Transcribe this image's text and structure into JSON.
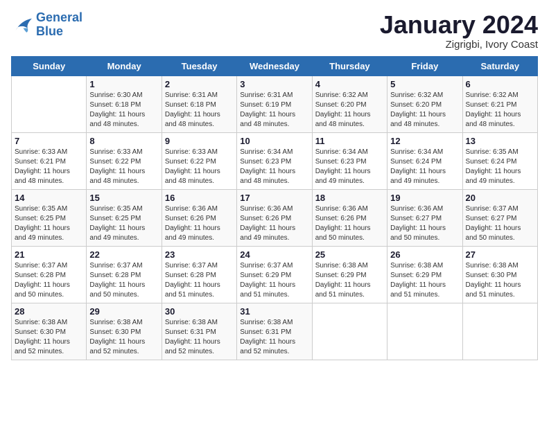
{
  "header": {
    "logo_line1": "General",
    "logo_line2": "Blue",
    "title": "January 2024",
    "subtitle": "Zigrigbi, Ivory Coast"
  },
  "weekdays": [
    "Sunday",
    "Monday",
    "Tuesday",
    "Wednesday",
    "Thursday",
    "Friday",
    "Saturday"
  ],
  "weeks": [
    [
      {
        "day": "",
        "detail": ""
      },
      {
        "day": "1",
        "detail": "Sunrise: 6:30 AM\nSunset: 6:18 PM\nDaylight: 11 hours\nand 48 minutes."
      },
      {
        "day": "2",
        "detail": "Sunrise: 6:31 AM\nSunset: 6:18 PM\nDaylight: 11 hours\nand 48 minutes."
      },
      {
        "day": "3",
        "detail": "Sunrise: 6:31 AM\nSunset: 6:19 PM\nDaylight: 11 hours\nand 48 minutes."
      },
      {
        "day": "4",
        "detail": "Sunrise: 6:32 AM\nSunset: 6:20 PM\nDaylight: 11 hours\nand 48 minutes."
      },
      {
        "day": "5",
        "detail": "Sunrise: 6:32 AM\nSunset: 6:20 PM\nDaylight: 11 hours\nand 48 minutes."
      },
      {
        "day": "6",
        "detail": "Sunrise: 6:32 AM\nSunset: 6:21 PM\nDaylight: 11 hours\nand 48 minutes."
      }
    ],
    [
      {
        "day": "7",
        "detail": "Sunrise: 6:33 AM\nSunset: 6:21 PM\nDaylight: 11 hours\nand 48 minutes."
      },
      {
        "day": "8",
        "detail": "Sunrise: 6:33 AM\nSunset: 6:22 PM\nDaylight: 11 hours\nand 48 minutes."
      },
      {
        "day": "9",
        "detail": "Sunrise: 6:33 AM\nSunset: 6:22 PM\nDaylight: 11 hours\nand 48 minutes."
      },
      {
        "day": "10",
        "detail": "Sunrise: 6:34 AM\nSunset: 6:23 PM\nDaylight: 11 hours\nand 48 minutes."
      },
      {
        "day": "11",
        "detail": "Sunrise: 6:34 AM\nSunset: 6:23 PM\nDaylight: 11 hours\nand 49 minutes."
      },
      {
        "day": "12",
        "detail": "Sunrise: 6:34 AM\nSunset: 6:24 PM\nDaylight: 11 hours\nand 49 minutes."
      },
      {
        "day": "13",
        "detail": "Sunrise: 6:35 AM\nSunset: 6:24 PM\nDaylight: 11 hours\nand 49 minutes."
      }
    ],
    [
      {
        "day": "14",
        "detail": "Sunrise: 6:35 AM\nSunset: 6:25 PM\nDaylight: 11 hours\nand 49 minutes."
      },
      {
        "day": "15",
        "detail": "Sunrise: 6:35 AM\nSunset: 6:25 PM\nDaylight: 11 hours\nand 49 minutes."
      },
      {
        "day": "16",
        "detail": "Sunrise: 6:36 AM\nSunset: 6:26 PM\nDaylight: 11 hours\nand 49 minutes."
      },
      {
        "day": "17",
        "detail": "Sunrise: 6:36 AM\nSunset: 6:26 PM\nDaylight: 11 hours\nand 49 minutes."
      },
      {
        "day": "18",
        "detail": "Sunrise: 6:36 AM\nSunset: 6:26 PM\nDaylight: 11 hours\nand 50 minutes."
      },
      {
        "day": "19",
        "detail": "Sunrise: 6:36 AM\nSunset: 6:27 PM\nDaylight: 11 hours\nand 50 minutes."
      },
      {
        "day": "20",
        "detail": "Sunrise: 6:37 AM\nSunset: 6:27 PM\nDaylight: 11 hours\nand 50 minutes."
      }
    ],
    [
      {
        "day": "21",
        "detail": "Sunrise: 6:37 AM\nSunset: 6:28 PM\nDaylight: 11 hours\nand 50 minutes."
      },
      {
        "day": "22",
        "detail": "Sunrise: 6:37 AM\nSunset: 6:28 PM\nDaylight: 11 hours\nand 50 minutes."
      },
      {
        "day": "23",
        "detail": "Sunrise: 6:37 AM\nSunset: 6:28 PM\nDaylight: 11 hours\nand 51 minutes."
      },
      {
        "day": "24",
        "detail": "Sunrise: 6:37 AM\nSunset: 6:29 PM\nDaylight: 11 hours\nand 51 minutes."
      },
      {
        "day": "25",
        "detail": "Sunrise: 6:38 AM\nSunset: 6:29 PM\nDaylight: 11 hours\nand 51 minutes."
      },
      {
        "day": "26",
        "detail": "Sunrise: 6:38 AM\nSunset: 6:29 PM\nDaylight: 11 hours\nand 51 minutes."
      },
      {
        "day": "27",
        "detail": "Sunrise: 6:38 AM\nSunset: 6:30 PM\nDaylight: 11 hours\nand 51 minutes."
      }
    ],
    [
      {
        "day": "28",
        "detail": "Sunrise: 6:38 AM\nSunset: 6:30 PM\nDaylight: 11 hours\nand 52 minutes."
      },
      {
        "day": "29",
        "detail": "Sunrise: 6:38 AM\nSunset: 6:30 PM\nDaylight: 11 hours\nand 52 minutes."
      },
      {
        "day": "30",
        "detail": "Sunrise: 6:38 AM\nSunset: 6:31 PM\nDaylight: 11 hours\nand 52 minutes."
      },
      {
        "day": "31",
        "detail": "Sunrise: 6:38 AM\nSunset: 6:31 PM\nDaylight: 11 hours\nand 52 minutes."
      },
      {
        "day": "",
        "detail": ""
      },
      {
        "day": "",
        "detail": ""
      },
      {
        "day": "",
        "detail": ""
      }
    ]
  ]
}
